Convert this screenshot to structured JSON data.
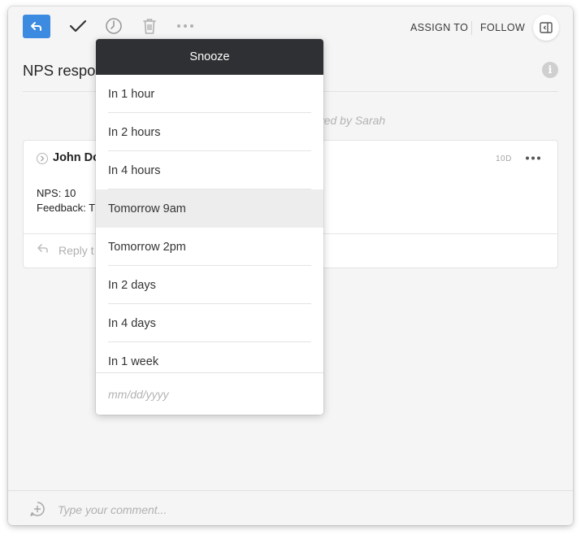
{
  "toolbar": {
    "assign_label": "ASSIGN TO",
    "follow_label": "FOLLOW",
    "icons": [
      "reply-icon",
      "check-icon",
      "clock-icon",
      "trash-icon",
      "more-icon",
      "panel-icon"
    ],
    "accent_color": "#3d8be0"
  },
  "conversation": {
    "title": "NPS respo",
    "archived_note": "hived by Sarah"
  },
  "message": {
    "sender": "John Do",
    "time": "10D",
    "lines": [
      "NPS: 10",
      "Feedback: T"
    ],
    "reply_placeholder": "Reply t"
  },
  "snooze": {
    "title": "Snooze",
    "items": [
      {
        "label": "In 1 hour"
      },
      {
        "label": "In 2 hours"
      },
      {
        "label": "In 4 hours"
      },
      {
        "label": "Tomorrow 9am"
      },
      {
        "label": "Tomorrow 2pm"
      },
      {
        "label": "In 2 days"
      },
      {
        "label": "In 4 days"
      },
      {
        "label": "In 1 week"
      }
    ],
    "highlighted_index": 3,
    "date_placeholder": "mm/dd/yyyy",
    "header_color": "#2f3033"
  },
  "comment": {
    "placeholder": "Type your comment..."
  }
}
